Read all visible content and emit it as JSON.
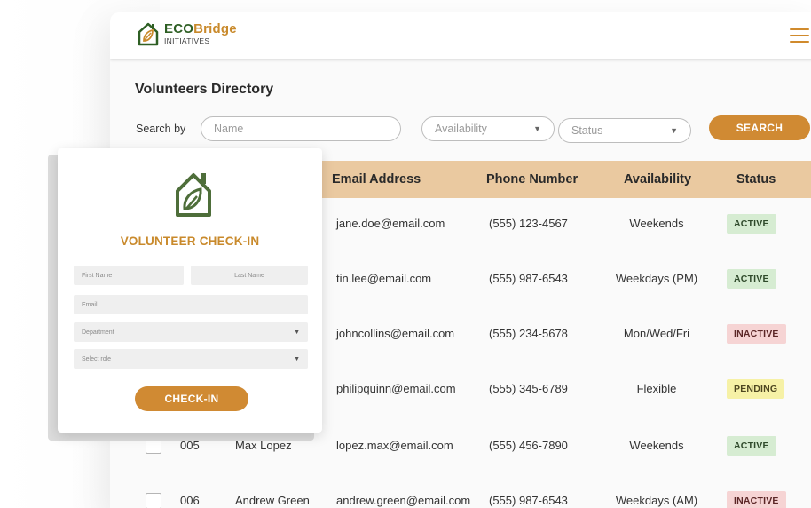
{
  "app": {
    "logo": {
      "brand_part1": "ECO",
      "brand_part2": "Bridge",
      "subtitle": "INITIATIVES"
    },
    "menu_icon": "hamburger-menu-icon"
  },
  "directory": {
    "title": "Volunteers Directory",
    "search_label": "Search by",
    "name_placeholder": "Name",
    "availability_placeholder": "Availability",
    "status_placeholder": "Status",
    "search_button": "SEARCH"
  },
  "table": {
    "headers": {
      "email": "Email Address",
      "phone": "Phone Number",
      "availability": "Availability",
      "status": "Status"
    },
    "rows": [
      {
        "id": "",
        "name": "",
        "email": "jane.doe@email.com",
        "phone": "(555) 123-4567",
        "availability": "Weekends",
        "status": "ACTIVE"
      },
      {
        "id": "",
        "name": "",
        "email": "tin.lee@email.com",
        "phone": "(555) 987-6543",
        "availability": "Weekdays (PM)",
        "status": "ACTIVE"
      },
      {
        "id": "",
        "name": "",
        "email": "johncollins@email.com",
        "phone": "(555) 234-5678",
        "availability": "Mon/Wed/Fri",
        "status": "INACTIVE"
      },
      {
        "id": "",
        "name": "",
        "email": "philipquinn@email.com",
        "phone": "(555) 345-6789",
        "availability": "Flexible",
        "status": "PENDING"
      },
      {
        "id": "005",
        "name": "Max Lopez",
        "email": "lopez.max@email.com",
        "phone": "(555) 456-7890",
        "availability": "Weekends",
        "status": "ACTIVE"
      },
      {
        "id": "006",
        "name": "Andrew Green",
        "email": "andrew.green@email.com",
        "phone": "(555) 987-6543",
        "availability": "Weekdays (AM)",
        "status": "INACTIVE"
      }
    ]
  },
  "checkin": {
    "icon": "eco-house-leaf-icon",
    "title": "VOLUNTEER CHECK-IN",
    "first_name_placeholder": "First Name",
    "last_name_placeholder": "Last Name",
    "email_placeholder": "Email",
    "department_placeholder": "Department",
    "role_placeholder": "Select role",
    "button": "CHECK-IN"
  },
  "colors": {
    "accent": "#d08a33",
    "brand_green": "#2e5f24",
    "header_row": "#eac9a0",
    "active_badge": "#d6ecd2",
    "inactive_badge": "#f6d4d4",
    "pending_badge": "#f6f1a6"
  }
}
